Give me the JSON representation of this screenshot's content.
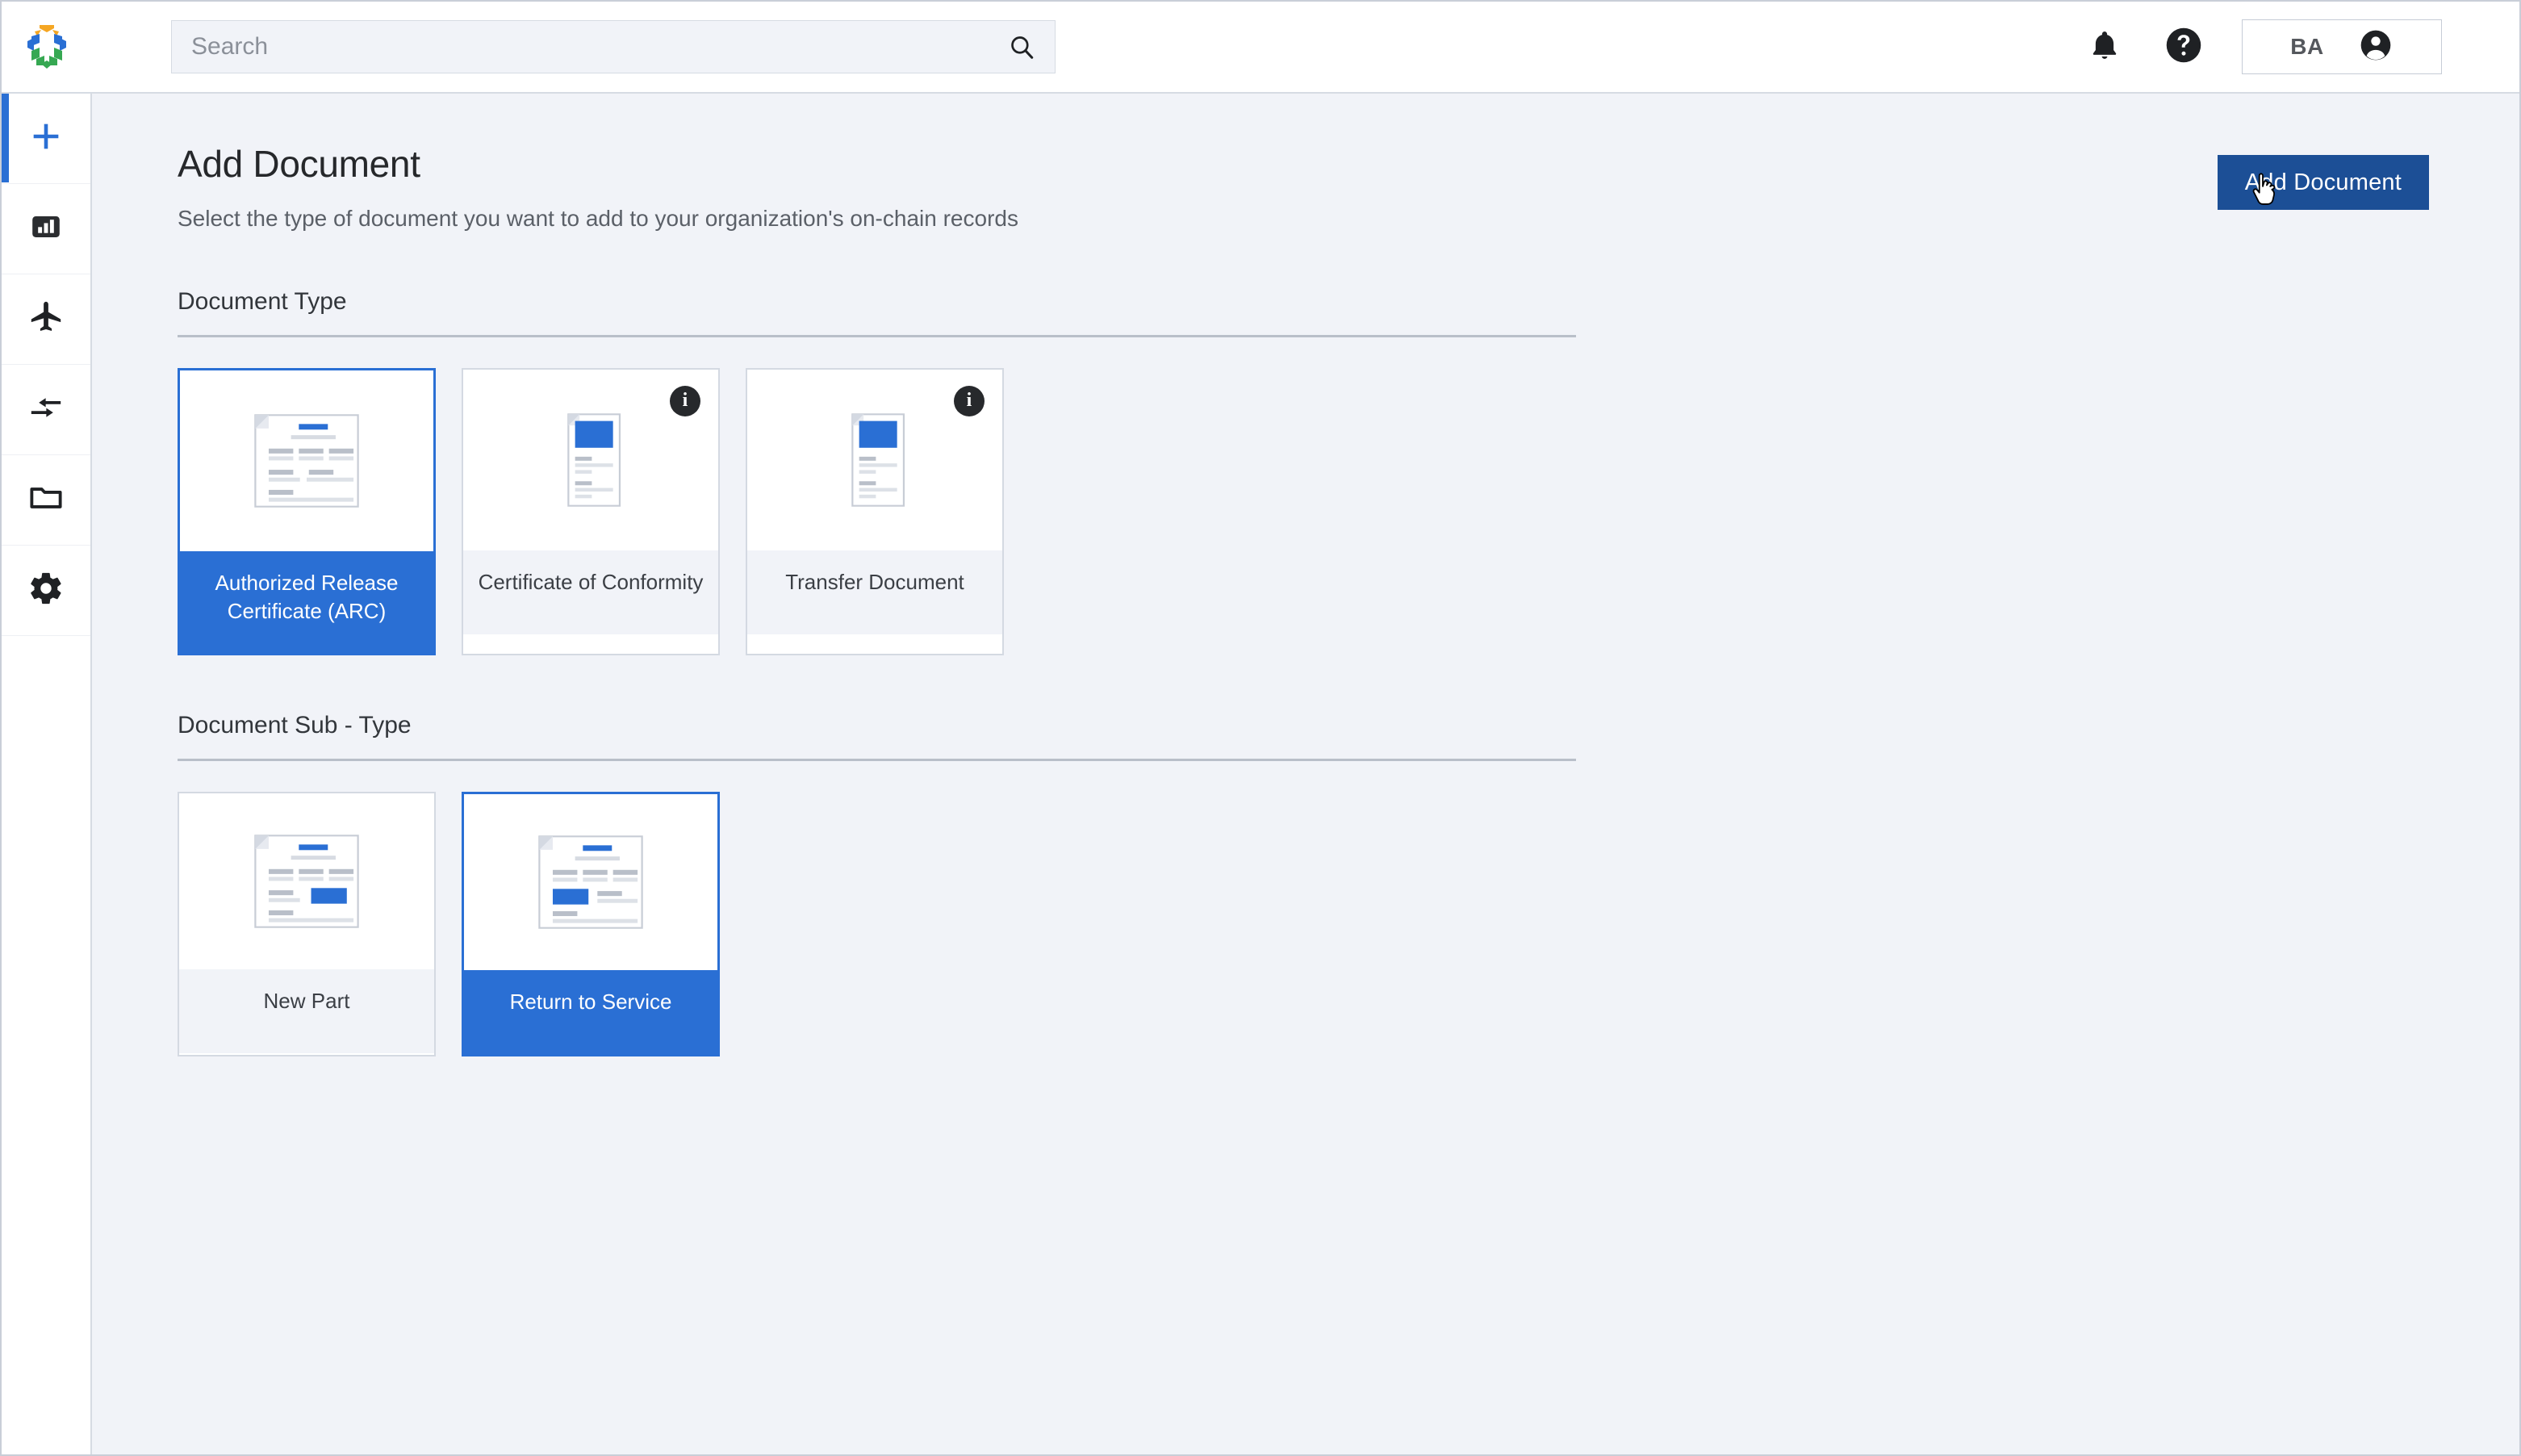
{
  "header": {
    "logo_name": "aerochain-logo",
    "search": {
      "placeholder": "Search",
      "value": "",
      "icon": "search-icon"
    },
    "notifications_icon": "bell-icon",
    "help_icon": "help-circle-icon",
    "account": {
      "initials": "BA",
      "icon": "account-circle-icon"
    }
  },
  "sidebar": {
    "items": [
      {
        "name": "sidebar-item-add",
        "icon": "plus-icon",
        "active": true
      },
      {
        "name": "sidebar-item-dashboard",
        "icon": "bar-chart-icon",
        "active": false
      },
      {
        "name": "sidebar-item-aircraft",
        "icon": "airplane-icon",
        "active": false
      },
      {
        "name": "sidebar-item-transfers",
        "icon": "transfer-arrows-icon",
        "active": false
      },
      {
        "name": "sidebar-item-documents",
        "icon": "folder-icon",
        "active": false
      },
      {
        "name": "sidebar-item-settings",
        "icon": "gear-icon",
        "active": false
      }
    ]
  },
  "main": {
    "title": "Add Document",
    "subtitle": "Select the type of document you want to add to your organization's on-chain records",
    "primary_button": "Add Document",
    "sections": [
      {
        "label": "Document Type",
        "cards": [
          {
            "label": "Authorized Release Certificate (ARC)",
            "selected": true,
            "has_info": false,
            "thumb": "document-landscape-blue-title"
          },
          {
            "label": "Certificate of Conformity",
            "selected": false,
            "has_info": true,
            "info_label": "i",
            "thumb": "document-portrait-blue-block"
          },
          {
            "label": "Transfer Document",
            "selected": false,
            "has_info": true,
            "info_label": "i",
            "thumb": "document-portrait-blue-block"
          }
        ]
      },
      {
        "label": "Document Sub - Type",
        "cards": [
          {
            "label": "New Part",
            "selected": false,
            "has_info": false,
            "thumb": "document-landscape-blue-right"
          },
          {
            "label": "Return to Service",
            "selected": true,
            "has_info": false,
            "thumb": "document-landscape-blue-left"
          }
        ]
      }
    ]
  },
  "colors": {
    "accent_blue": "#2a6fd4",
    "button_blue": "#1c4f96",
    "page_background": "#f1f3f8",
    "border_gray": "#d4d9e2",
    "badge_dark": "#27292c"
  }
}
